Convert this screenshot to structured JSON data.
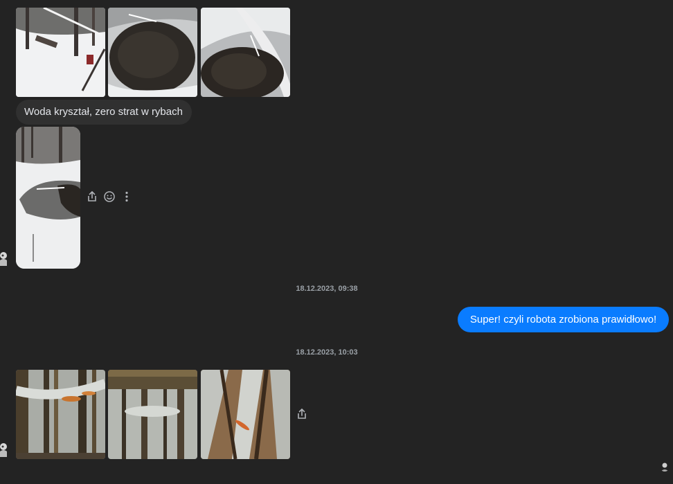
{
  "conversation": {
    "messages": {
      "incoming_text": "Woda kryształ, zero strat w rybach",
      "outgoing_text": "Super! czyli robota zrobiona prawidłowo!"
    },
    "timestamps": {
      "first": "18.12.2023, 09:38",
      "second": "18.12.2023, 10:03"
    }
  },
  "icons": {
    "share": "share-icon",
    "react": "smiley-icon",
    "more": "more-vertical-icon"
  },
  "colors": {
    "background": "#232323",
    "incoming_bubble": "#303030",
    "outgoing_bubble": "#0a7cff"
  }
}
